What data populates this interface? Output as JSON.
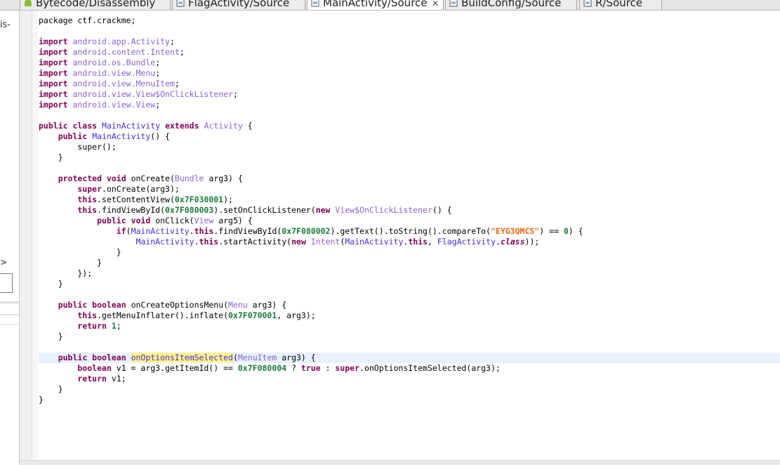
{
  "tabs": [
    {
      "label": "Bytecode/Disassembly",
      "icon": "android-icon"
    },
    {
      "label": "FlagActivity/Source",
      "icon": "java-file-icon"
    },
    {
      "label": "MainActivity/Source",
      "icon": "java-file-icon",
      "active": true
    },
    {
      "label": "BuildConfig/Source",
      "icon": "java-file-icon"
    },
    {
      "label": "R/Source",
      "icon": "java-file-icon"
    }
  ],
  "left_panel": {
    "fragment_text": "is-",
    "expand_arrow": ">"
  },
  "colors": {
    "keyword": "#7f0055",
    "type": "#8a63d2",
    "class_ref": "#4b2bd6",
    "number": "#1d7a3a",
    "string": "#e8650c",
    "highlight": "#fff38a",
    "current_line": "#e8f2fe"
  },
  "code": {
    "current_line_index": 32,
    "lines": [
      [
        [
          "p",
          "package ctf.crackme;"
        ]
      ],
      [],
      [
        [
          "k",
          "import"
        ],
        [
          "p",
          " "
        ],
        [
          "t",
          "android.app.Activity"
        ],
        [
          "p",
          ";"
        ]
      ],
      [
        [
          "k",
          "import"
        ],
        [
          "p",
          " "
        ],
        [
          "t",
          "android.content.Intent"
        ],
        [
          "p",
          ";"
        ]
      ],
      [
        [
          "k",
          "import"
        ],
        [
          "p",
          " "
        ],
        [
          "t",
          "android.os.Bundle"
        ],
        [
          "p",
          ";"
        ]
      ],
      [
        [
          "k",
          "import"
        ],
        [
          "p",
          " "
        ],
        [
          "t",
          "android.view.Menu"
        ],
        [
          "p",
          ";"
        ]
      ],
      [
        [
          "k",
          "import"
        ],
        [
          "p",
          " "
        ],
        [
          "t",
          "android.view.MenuItem"
        ],
        [
          "p",
          ";"
        ]
      ],
      [
        [
          "k",
          "import"
        ],
        [
          "p",
          " "
        ],
        [
          "t",
          "android.view.View$OnClickListener"
        ],
        [
          "p",
          ";"
        ]
      ],
      [
        [
          "k",
          "import"
        ],
        [
          "p",
          " "
        ],
        [
          "t",
          "android.view.View"
        ],
        [
          "p",
          ";"
        ]
      ],
      [],
      [
        [
          "k",
          "public class"
        ],
        [
          "p",
          " "
        ],
        [
          "c",
          "MainActivity"
        ],
        [
          "p",
          " "
        ],
        [
          "k",
          "extends"
        ],
        [
          "p",
          " "
        ],
        [
          "t",
          "Activity"
        ],
        [
          "p",
          " {"
        ]
      ],
      [
        [
          "p",
          "    "
        ],
        [
          "k",
          "public"
        ],
        [
          "p",
          " "
        ],
        [
          "c",
          "MainActivity"
        ],
        [
          "p",
          "() {"
        ]
      ],
      [
        [
          "p",
          "        super();"
        ]
      ],
      [
        [
          "p",
          "    }"
        ]
      ],
      [],
      [
        [
          "p",
          "    "
        ],
        [
          "k",
          "protected void"
        ],
        [
          "p",
          " onCreate("
        ],
        [
          "t",
          "Bundle"
        ],
        [
          "p",
          " arg3) {"
        ]
      ],
      [
        [
          "p",
          "        "
        ],
        [
          "k",
          "super"
        ],
        [
          "p",
          ".onCreate(arg3);"
        ]
      ],
      [
        [
          "p",
          "        "
        ],
        [
          "k",
          "this"
        ],
        [
          "p",
          ".setContentView("
        ],
        [
          "n",
          "0x7F030001"
        ],
        [
          "p",
          ");"
        ]
      ],
      [
        [
          "p",
          "        "
        ],
        [
          "k",
          "this"
        ],
        [
          "p",
          ".findViewById("
        ],
        [
          "n",
          "0x7F080003"
        ],
        [
          "p",
          ").setOnClickListener("
        ],
        [
          "k",
          "new"
        ],
        [
          "p",
          " "
        ],
        [
          "t",
          "View$OnClickListener"
        ],
        [
          "p",
          "() {"
        ]
      ],
      [
        [
          "p",
          "            "
        ],
        [
          "k",
          "public void"
        ],
        [
          "p",
          " onClick("
        ],
        [
          "t",
          "View"
        ],
        [
          "p",
          " arg5) {"
        ]
      ],
      [
        [
          "p",
          "                "
        ],
        [
          "k",
          "if"
        ],
        [
          "p",
          "("
        ],
        [
          "c",
          "MainActivity"
        ],
        [
          "p",
          "."
        ],
        [
          "k",
          "this"
        ],
        [
          "p",
          ".findViewById("
        ],
        [
          "n",
          "0x7F080002"
        ],
        [
          "p",
          ").getText().toString().compareTo("
        ],
        [
          "s",
          "\"EYG3QMCS\""
        ],
        [
          "p",
          ") == "
        ],
        [
          "n",
          "0"
        ],
        [
          "p",
          ") {"
        ]
      ],
      [
        [
          "p",
          "                    "
        ],
        [
          "c",
          "MainActivity"
        ],
        [
          "p",
          "."
        ],
        [
          "k",
          "this"
        ],
        [
          "p",
          ".startActivity("
        ],
        [
          "k",
          "new"
        ],
        [
          "p",
          " "
        ],
        [
          "t",
          "Intent"
        ],
        [
          "p",
          "("
        ],
        [
          "c",
          "MainActivity"
        ],
        [
          "p",
          "."
        ],
        [
          "k",
          "this"
        ],
        [
          "p",
          ", "
        ],
        [
          "c",
          "FlagActivity"
        ],
        [
          "p",
          "."
        ],
        [
          "i",
          "class"
        ],
        [
          "p",
          "));"
        ]
      ],
      [
        [
          "p",
          "                }"
        ]
      ],
      [
        [
          "p",
          "            }"
        ]
      ],
      [
        [
          "p",
          "        });"
        ]
      ],
      [
        [
          "p",
          "    }"
        ]
      ],
      [],
      [
        [
          "p",
          "    "
        ],
        [
          "k",
          "public boolean"
        ],
        [
          "p",
          " onCreateOptionsMenu("
        ],
        [
          "t",
          "Menu"
        ],
        [
          "p",
          " arg3) {"
        ]
      ],
      [
        [
          "p",
          "        "
        ],
        [
          "k",
          "this"
        ],
        [
          "p",
          ".getMenuInflater().inflate("
        ],
        [
          "n",
          "0x7F070001"
        ],
        [
          "p",
          ", arg3);"
        ]
      ],
      [
        [
          "p",
          "        "
        ],
        [
          "k",
          "return"
        ],
        [
          "p",
          " "
        ],
        [
          "n",
          "1"
        ],
        [
          "p",
          ";"
        ]
      ],
      [
        [
          "p",
          "    }"
        ]
      ],
      [],
      [
        [
          "p",
          "    "
        ],
        [
          "k",
          "public boolean"
        ],
        [
          "p",
          " "
        ],
        [
          "h",
          "onOptionsItemSelected"
        ],
        [
          "p",
          "("
        ],
        [
          "t",
          "MenuItem"
        ],
        [
          "p",
          " arg3) {"
        ]
      ],
      [
        [
          "p",
          "        "
        ],
        [
          "k",
          "boolean"
        ],
        [
          "p",
          " v1 = arg3.getItemId() == "
        ],
        [
          "n",
          "0x7F080004"
        ],
        [
          "p",
          " ? "
        ],
        [
          "k",
          "true"
        ],
        [
          "p",
          " : "
        ],
        [
          "k",
          "super"
        ],
        [
          "p",
          ".onOptionsItemSelected(arg3);"
        ]
      ],
      [
        [
          "p",
          "        "
        ],
        [
          "k",
          "return"
        ],
        [
          "p",
          " v1;"
        ]
      ],
      [
        [
          "p",
          "    }"
        ]
      ],
      [
        [
          "p",
          "}"
        ]
      ]
    ]
  }
}
